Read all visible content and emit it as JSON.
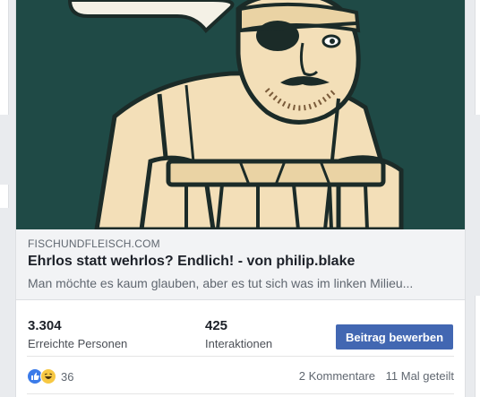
{
  "post": {
    "link": {
      "domain": "FISCHUNDFLEISCH.COM",
      "title": "Ehrlos statt wehrlos? Endlich! - von philip.blake",
      "description": "Man möchte es kaum glauben, aber es tut sich was im linken Milieu..."
    },
    "stats": {
      "reach_value": "3.304",
      "reach_label": "Erreichte Personen",
      "engagement_value": "425",
      "engagement_label": "Interaktionen"
    },
    "boost_label": "Beitrag bewerben",
    "reactions": {
      "icons": [
        "like-icon",
        "haha-icon"
      ],
      "count": "36",
      "comments": "2 Kommentare",
      "shares": "11 Mal geteilt"
    }
  },
  "colors": {
    "image_bg": "#1f4a46",
    "illustration": "#f3dfb8",
    "button": "#4267b2"
  }
}
